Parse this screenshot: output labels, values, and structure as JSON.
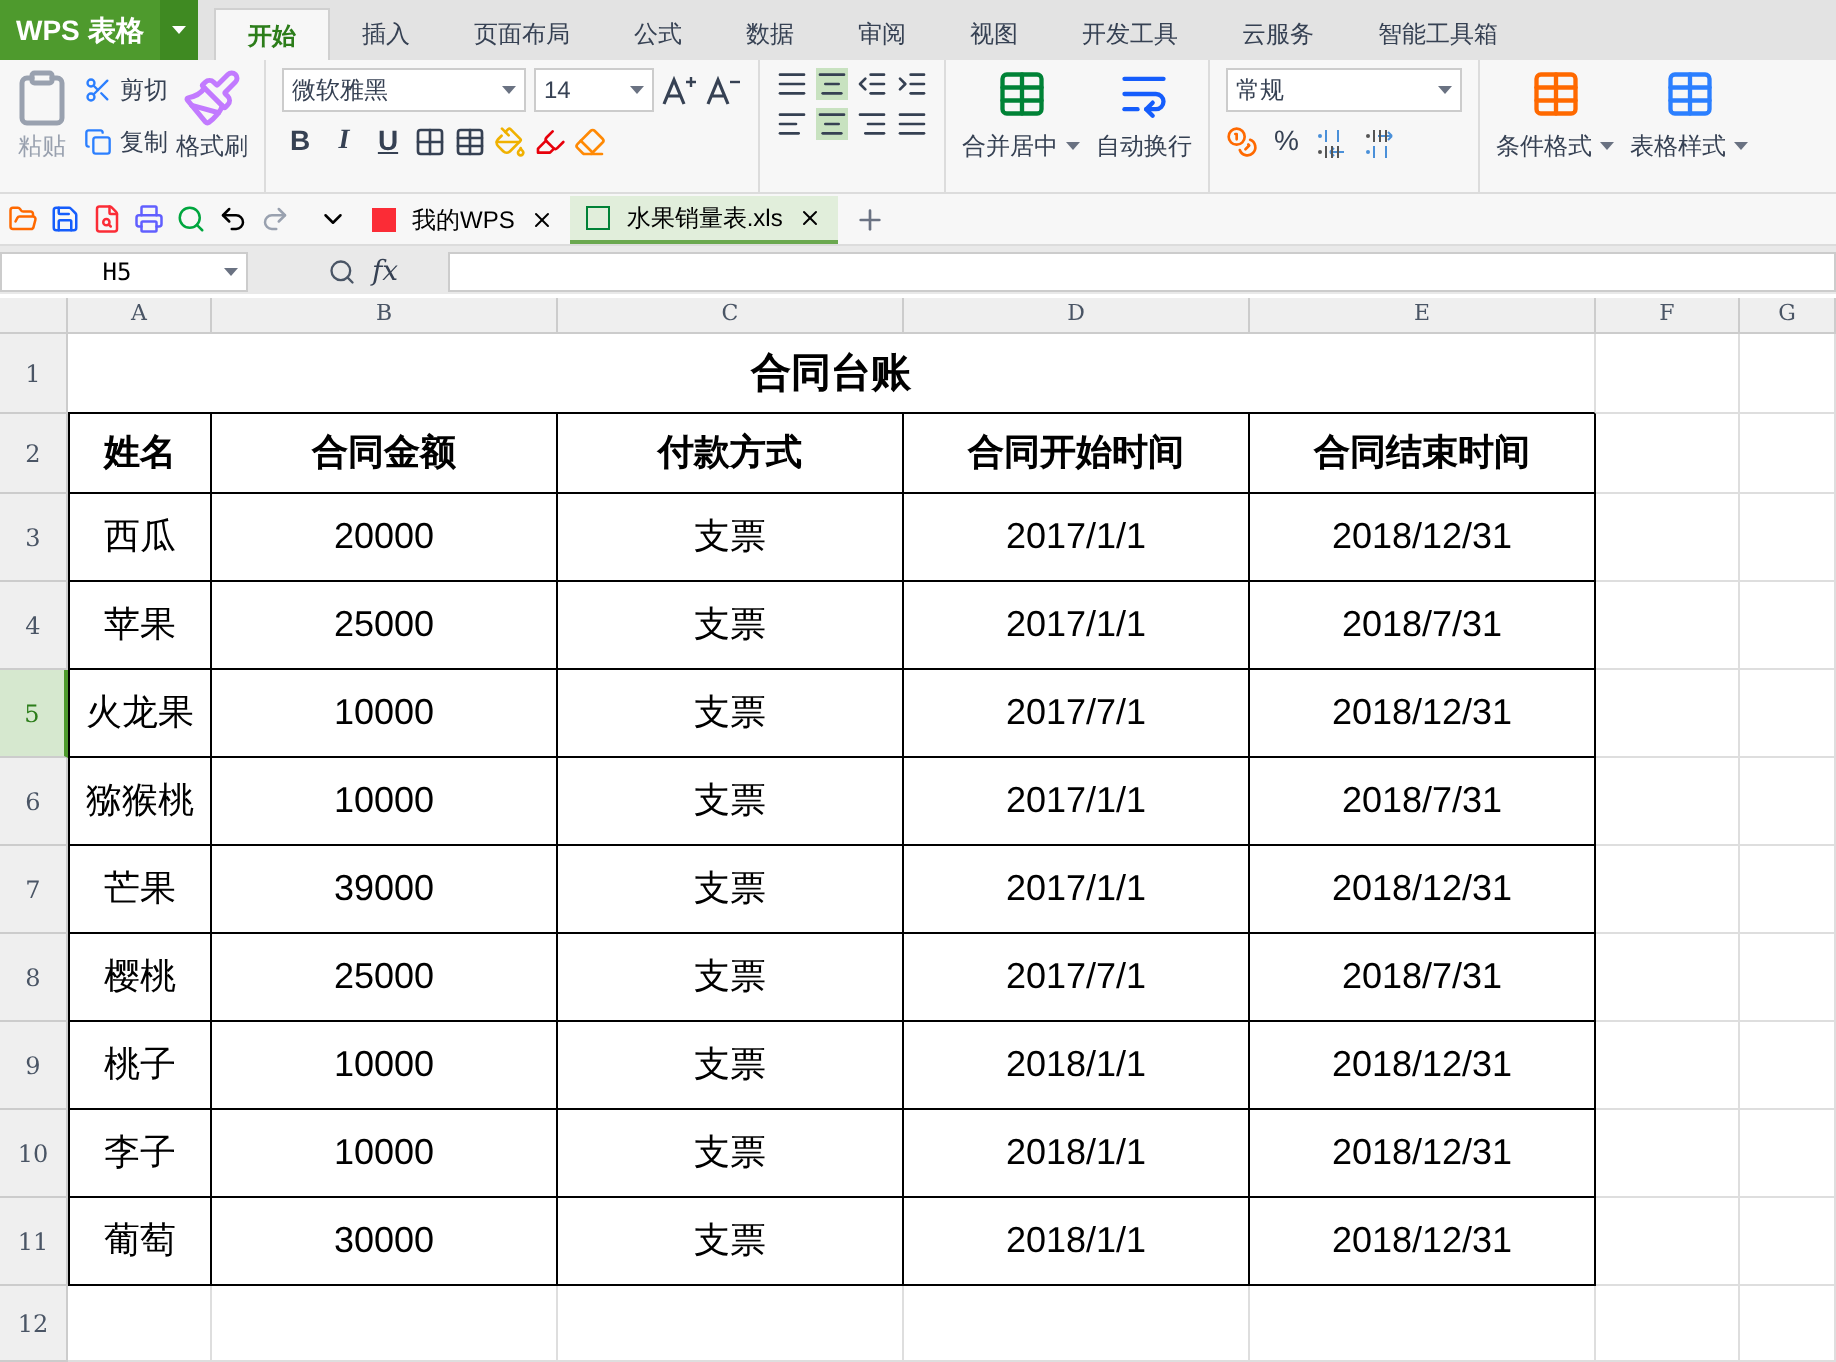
{
  "app_menu": {
    "label": "WPS 表格"
  },
  "ribbon_tabs": [
    {
      "label": "开始",
      "selected": true
    },
    {
      "label": "插入",
      "selected": false
    },
    {
      "label": "页面布局",
      "selected": false
    },
    {
      "label": "公式",
      "selected": false
    },
    {
      "label": "数据",
      "selected": false
    },
    {
      "label": "审阅",
      "selected": false
    },
    {
      "label": "视图",
      "selected": false
    },
    {
      "label": "开发工具",
      "selected": false
    },
    {
      "label": "云服务",
      "selected": false
    },
    {
      "label": "智能工具箱",
      "selected": false
    }
  ],
  "clipboard": {
    "paste": "粘贴",
    "cut": "剪切",
    "copy": "复制",
    "format_painter": "格式刷"
  },
  "font": {
    "name": "微软雅黑",
    "size": "14",
    "style_buttons": [
      "B",
      "I",
      "U"
    ]
  },
  "alignment": {
    "merge": "合并居中",
    "wrap": "自动换行"
  },
  "number": {
    "format": "常规",
    "percent": "%"
  },
  "styles": {
    "conditional": "条件格式",
    "table_style": "表格样式"
  },
  "doc_tabs": [
    {
      "label": "我的WPS",
      "selected": false
    },
    {
      "label": "水果销量表.xls",
      "selected": true
    }
  ],
  "formula_bar": {
    "cell_ref": "H5",
    "fx": "fx"
  },
  "sheet": {
    "columns": [
      "A",
      "B",
      "C",
      "D",
      "E",
      "F",
      "G"
    ],
    "row_headers": [
      {
        "label": "1",
        "selected": false
      },
      {
        "label": "2",
        "selected": false
      },
      {
        "label": "3",
        "selected": false
      },
      {
        "label": "4",
        "selected": false
      },
      {
        "label": "5",
        "selected": true
      },
      {
        "label": "6",
        "selected": false
      },
      {
        "label": "7",
        "selected": false
      },
      {
        "label": "8",
        "selected": false
      },
      {
        "label": "9",
        "selected": false
      },
      {
        "label": "10",
        "selected": false
      },
      {
        "label": "11",
        "selected": false
      },
      {
        "label": "12",
        "selected": false
      }
    ],
    "title": "合同台账",
    "header": [
      "姓名",
      "合同金额",
      "付款方式",
      "合同开始时间",
      "合同结束时间"
    ],
    "rows": [
      [
        "西瓜",
        "20000",
        "支票",
        "2017/1/1",
        "2018/12/31"
      ],
      [
        "苹果",
        "25000",
        "支票",
        "2017/1/1",
        "2018/7/31"
      ],
      [
        "火龙果",
        "10000",
        "支票",
        "2017/7/1",
        "2018/12/31"
      ],
      [
        "猕猴桃",
        "10000",
        "支票",
        "2017/1/1",
        "2018/7/31"
      ],
      [
        "芒果",
        "39000",
        "支票",
        "2017/1/1",
        "2018/12/31"
      ],
      [
        "樱桃",
        "25000",
        "支票",
        "2017/7/1",
        "2018/7/31"
      ],
      [
        "桃子",
        "10000",
        "支票",
        "2018/1/1",
        "2018/12/31"
      ],
      [
        "李子",
        "10000",
        "支票",
        "2018/1/1",
        "2018/12/31"
      ],
      [
        "葡萄",
        "30000",
        "支票",
        "2018/1/1",
        "2018/12/31"
      ]
    ]
  }
}
